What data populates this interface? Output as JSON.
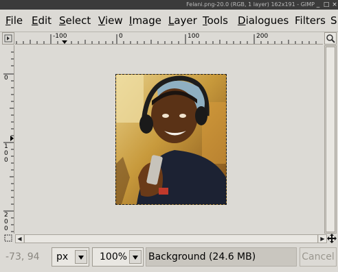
{
  "window": {
    "title": "Felani.png-20.0 (RGB, 1 layer) 162x191 - GIMP",
    "buttons": [
      "_",
      "□",
      "×"
    ]
  },
  "menubar": {
    "items": [
      {
        "mnemonic": "F",
        "rest": "ile"
      },
      {
        "mnemonic": "E",
        "rest": "dit"
      },
      {
        "mnemonic": "S",
        "rest": "elect"
      },
      {
        "mnemonic": "V",
        "rest": "iew"
      },
      {
        "mnemonic": "I",
        "rest": "mage"
      },
      {
        "mnemonic": "L",
        "rest": "ayer"
      },
      {
        "mnemonic": "T",
        "rest": "ools"
      },
      {
        "mnemonic": "D",
        "rest": "ialogues"
      },
      {
        "mnemonic": "",
        "rest": "Filters"
      },
      {
        "mnemonic": "S",
        "rest": ""
      }
    ]
  },
  "rulers": {
    "horizontal_labels": [
      "-100",
      "0",
      "100",
      "200"
    ],
    "vertical_labels": [
      [
        "0"
      ],
      [
        "1",
        "0",
        "0"
      ],
      [
        "2",
        "0",
        "0"
      ]
    ]
  },
  "statusbar": {
    "pointer_coords": "-73, 94",
    "unit": "px",
    "zoom": "100%",
    "layer_info": "Background (24.6 MB)",
    "cancel_label": "Cancel"
  },
  "colors": {
    "chrome": "#dcdad5",
    "titlebar": "#3b3b3b",
    "selection_border": "#1a1a1a"
  },
  "icons": {
    "ruler_corner": "menu-arrow-icon",
    "zoom_corner": "zoom-icon",
    "quick_mask": "quick-mask-icon",
    "navigate": "navigate-icon"
  }
}
